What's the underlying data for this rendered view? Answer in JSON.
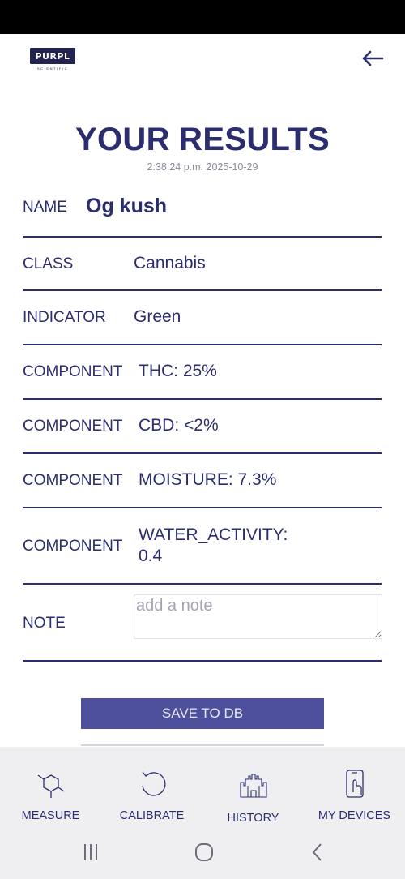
{
  "app": {
    "logo_text": "PURPL",
    "logo_subtext": "SCIENTIFIC"
  },
  "header": {
    "title": "YOUR RESULTS",
    "timestamp": "2:38:24 p.m. 2025-10-29"
  },
  "results": {
    "name": {
      "label": "NAME",
      "value": "Og kush"
    },
    "class": {
      "label": "CLASS",
      "value": "Cannabis"
    },
    "indicator": {
      "label": "INDICATOR",
      "value": "Green"
    },
    "components": [
      {
        "label": "COMPONENT",
        "value": "THC: 25%"
      },
      {
        "label": "COMPONENT",
        "value": "CBD: <2%"
      },
      {
        "label": "COMPONENT",
        "value": "MOISTURE: 7.3%"
      },
      {
        "label": "COMPONENT",
        "value_line1": "WATER_ACTIVITY:",
        "value_line2": "0.4"
      }
    ],
    "note": {
      "label": "NOTE",
      "placeholder": "add a note",
      "value": ""
    }
  },
  "actions": {
    "save_label": "SAVE TO DB"
  },
  "bottom_nav": {
    "items": [
      {
        "label": "MEASURE",
        "icon": "molecule-icon"
      },
      {
        "label": "CALIBRATE",
        "icon": "refresh-icon"
      },
      {
        "label": "HISTORY",
        "icon": "castle-icon"
      },
      {
        "label": "MY DEVICES",
        "icon": "phone-tap-icon"
      }
    ]
  },
  "system_nav": {
    "icons": [
      "recents-icon",
      "home-icon",
      "back-icon"
    ]
  },
  "colors": {
    "primary": "#2b2d6e",
    "button": "#4d4f9c",
    "nav_background": "#efeff1",
    "muted": "#8a8a9c"
  }
}
